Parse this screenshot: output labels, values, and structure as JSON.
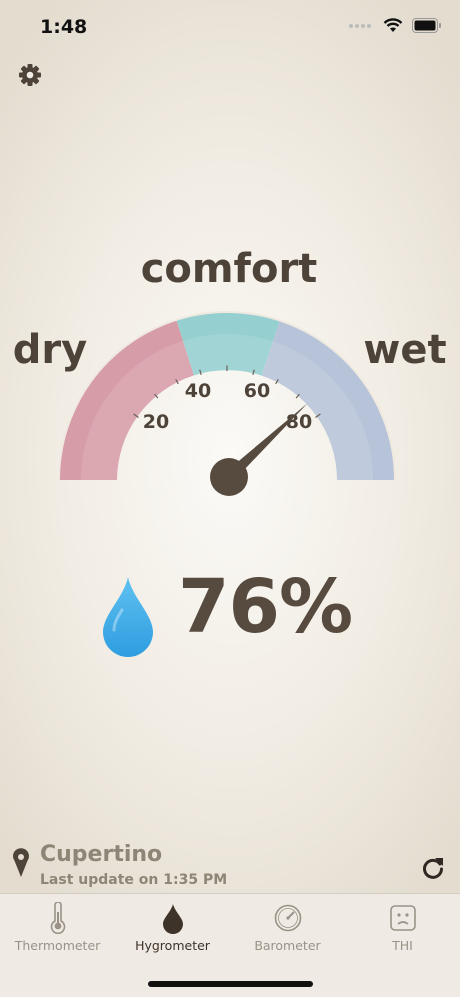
{
  "status_bar": {
    "time": "1:48"
  },
  "gauge": {
    "title": "comfort",
    "left_label": "dry",
    "right_label": "wet",
    "ticks": [
      "20",
      "40",
      "60",
      "80"
    ],
    "value_percent": 76,
    "colors": {
      "dry": "#d69ca8",
      "comfort": "#95cfd0",
      "wet": "#b7c3d9",
      "needle": "#574b40"
    }
  },
  "reading": {
    "humidity": "76%"
  },
  "location": {
    "city": "Cupertino",
    "last_update": "Last update on 1:35 PM"
  },
  "tabs": [
    {
      "label": "Thermometer",
      "icon": "thermometer-icon",
      "active": false
    },
    {
      "label": "Hygrometer",
      "icon": "drop-icon",
      "active": true
    },
    {
      "label": "Barometer",
      "icon": "barometer-icon",
      "active": false
    },
    {
      "label": "THI",
      "icon": "face-icon",
      "active": false
    }
  ]
}
